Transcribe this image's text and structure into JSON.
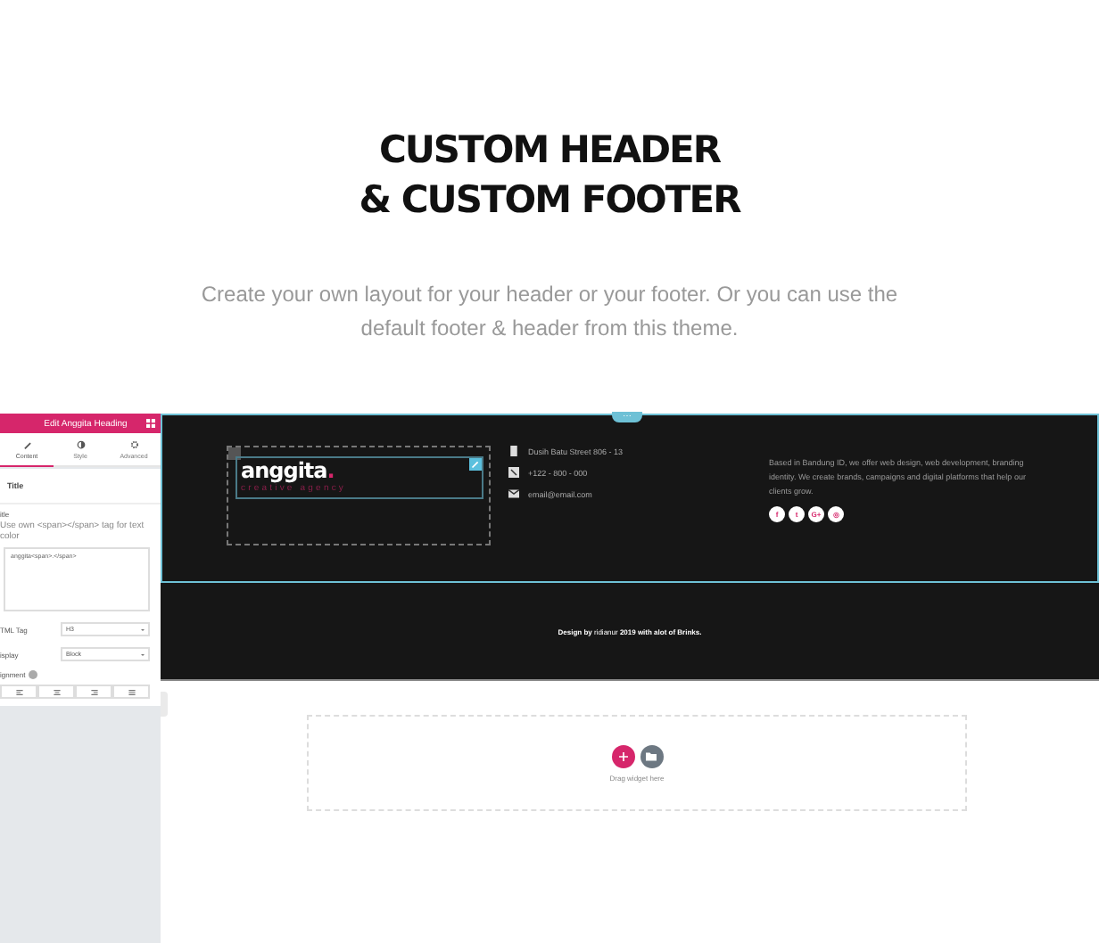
{
  "hero": {
    "title_lines": [
      "CUSTOM HEADER",
      "& CUSTOM FOOTER"
    ],
    "subtitle": "Create your own layout for your header or your footer. Or you can use the default footer & header from this theme."
  },
  "panel": {
    "title": "Edit Anggita Heading",
    "tabs": [
      {
        "label": "Content",
        "selected": true
      },
      {
        "label": "Style",
        "selected": false
      },
      {
        "label": "Advanced",
        "selected": false
      }
    ],
    "section": "Title",
    "field_label": "itle",
    "field_hint": "Use own <span></span> tag for text color",
    "field_value": "anggita<span>.</span>",
    "selects": [
      {
        "label": "TML Tag",
        "value": "H3"
      },
      {
        "label": "isplay",
        "value": "Block"
      }
    ],
    "alignment_label": "ignment"
  },
  "footer": {
    "section_handle": "⋯",
    "logo": "anggita",
    "logo_dot": ".",
    "tagline": "creative agency",
    "contacts": [
      {
        "kind": "address",
        "text": "Dusih Batu Street 806 - 13"
      },
      {
        "kind": "phone",
        "text": "+122 - 800 - 000"
      },
      {
        "kind": "email",
        "text": "email@email.com"
      }
    ],
    "about": "Based in Bandung ID, we offer web design, web development, branding identity. We create brands, campaigns and digital platforms that help our clients grow.",
    "socials": [
      {
        "label": "f"
      },
      {
        "label": "t"
      },
      {
        "label": "G+"
      },
      {
        "label": "◎"
      }
    ],
    "credit": "**Design by** ridianur **2019 with alot of Brinks.**"
  },
  "dropzone": {
    "hint": "Drag widget here"
  }
}
